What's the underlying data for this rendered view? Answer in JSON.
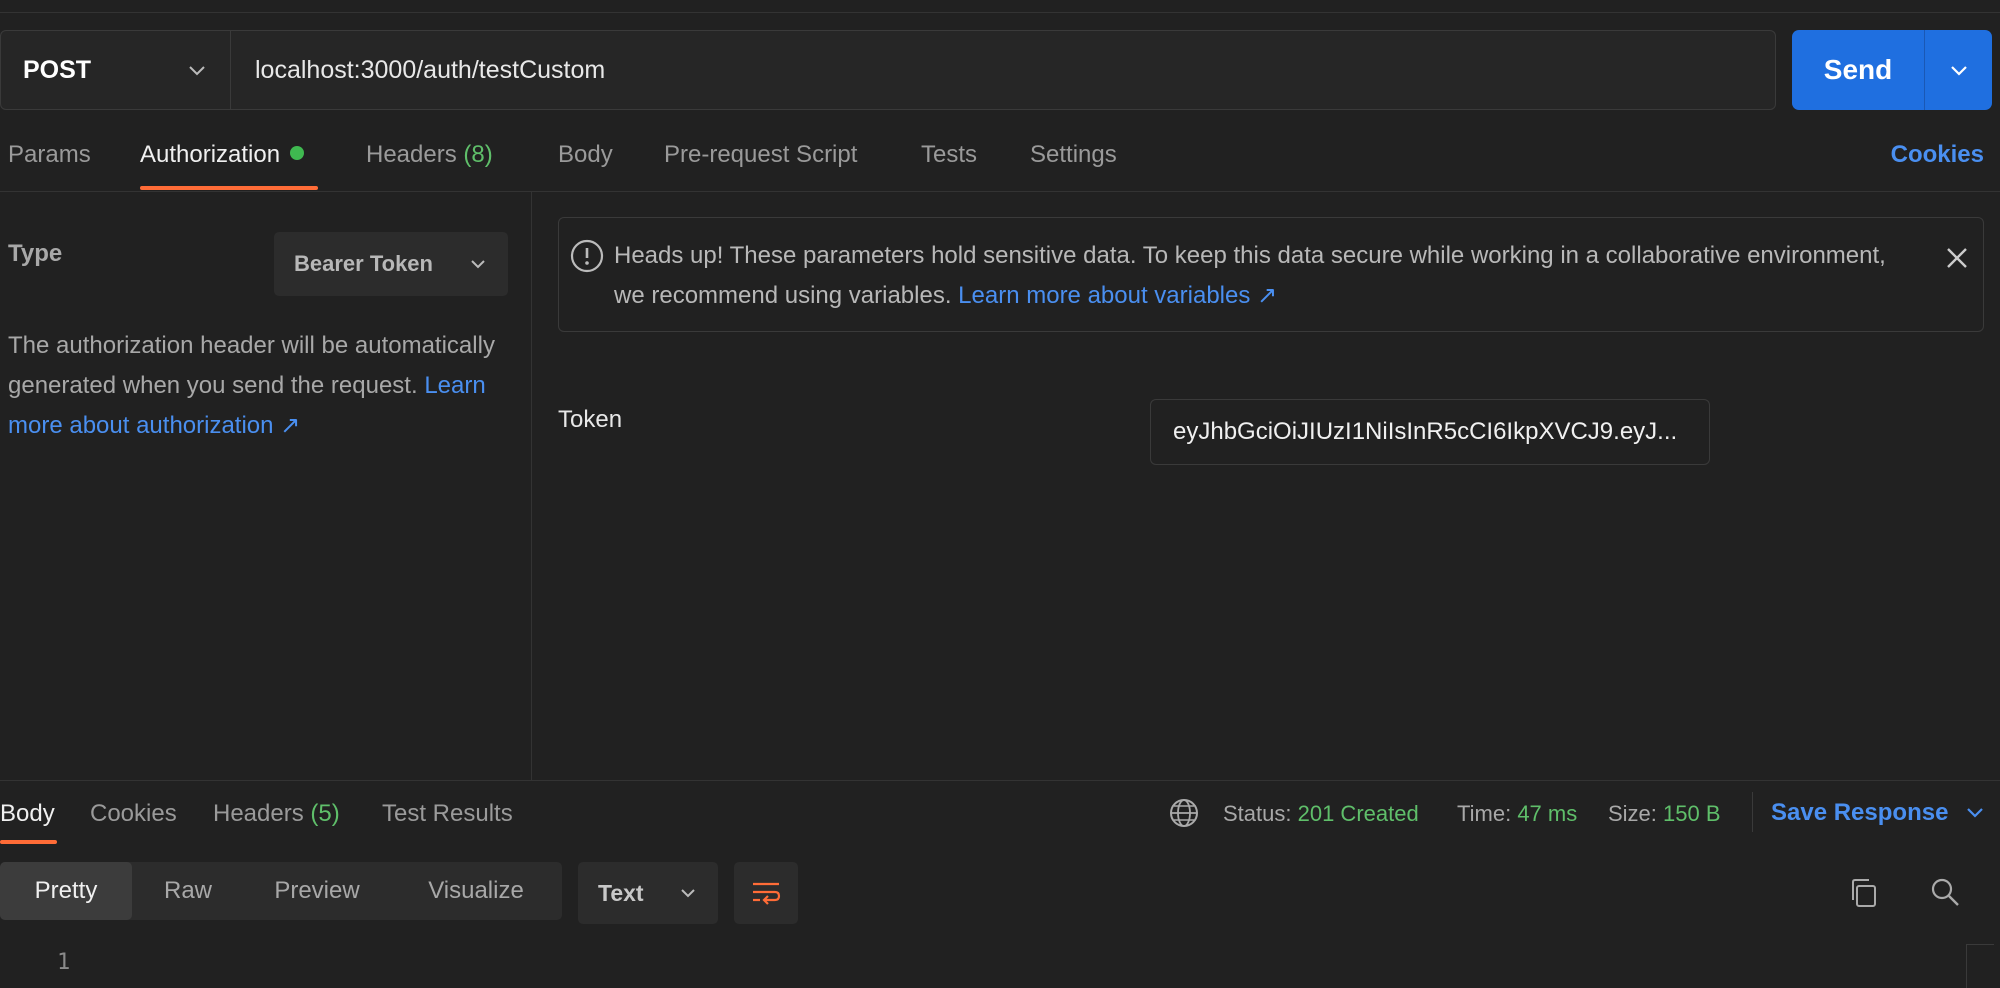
{
  "request": {
    "method": "POST",
    "url": "localhost:3000/auth/testCustom",
    "send_label": "Send"
  },
  "tabs": [
    {
      "label": "Params"
    },
    {
      "label": "Authorization"
    },
    {
      "label": "Headers",
      "count": "(8)"
    },
    {
      "label": "Body"
    },
    {
      "label": "Pre-request Script"
    },
    {
      "label": "Tests"
    },
    {
      "label": "Settings"
    }
  ],
  "active_tab": "Authorization",
  "cookies_label": "Cookies",
  "auth": {
    "type_label": "Type",
    "type_value": "Bearer Token",
    "description": "The authorization header will be automatically generated when you send the request.",
    "learn_more": "Learn more about authorization ↗"
  },
  "alert": {
    "text": "Heads up! These parameters hold sensitive data. To keep this data secure while working in a collaborative environment, we recommend using variables.",
    "link": "Learn more about variables ↗"
  },
  "token": {
    "label": "Token",
    "value": "eyJhbGciOiJIUzI1NiIsInR5cCI6IkpXVCJ9.eyJ..."
  },
  "response": {
    "tabs": [
      {
        "label": "Body"
      },
      {
        "label": "Cookies"
      },
      {
        "label": "Headers",
        "count": "(5)"
      },
      {
        "label": "Test Results"
      }
    ],
    "active_tab": "Body",
    "status_label": "Status:",
    "status_value": "201 Created",
    "time_label": "Time:",
    "time_value": "47 ms",
    "size_label": "Size:",
    "size_value": "150 B",
    "save_label": "Save Response",
    "views": [
      "Pretty",
      "Raw",
      "Preview",
      "Visualize"
    ],
    "active_view": "Pretty",
    "format": "Text",
    "line_number": "1"
  },
  "colors": {
    "accent": "#ff6c37",
    "send": "#1f6fe0",
    "link": "#4a8ff0",
    "success": "#5fbf6a"
  },
  "icons": [
    "chevron-down-icon",
    "alert-icon",
    "close-icon",
    "globe-icon",
    "wrap-icon",
    "copy-icon",
    "search-icon"
  ]
}
